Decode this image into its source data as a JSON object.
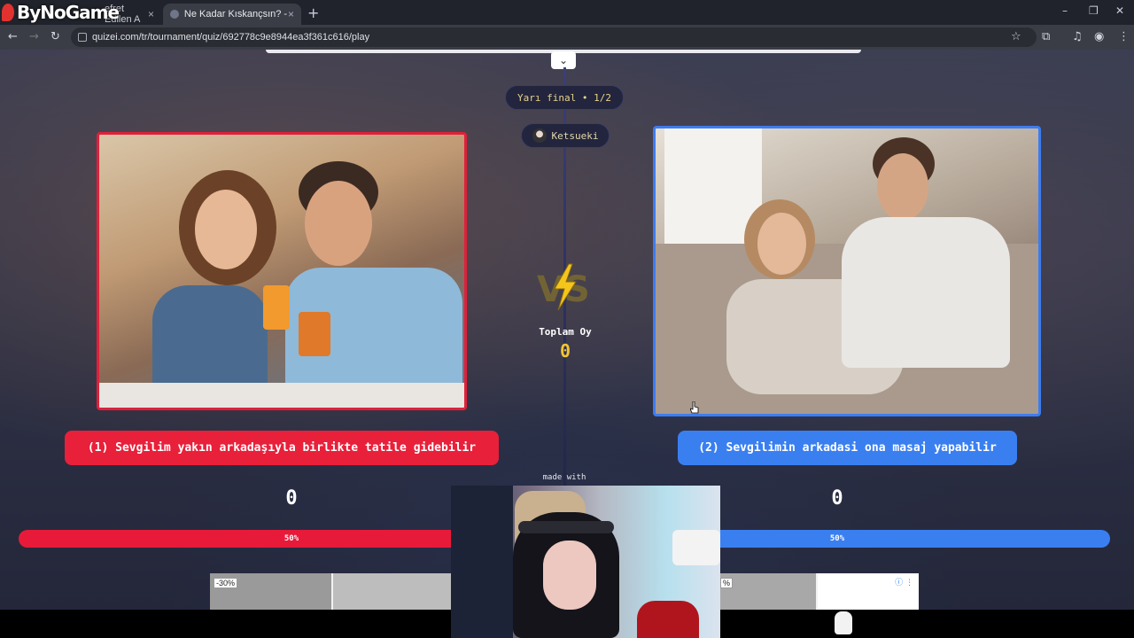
{
  "browser": {
    "tabs": [
      {
        "title": "efret Edilen A"
      },
      {
        "title": "Ne Kadar Kıskançsın? - Tier List"
      }
    ],
    "url": "quizei.com/tr/tournament/quiz/692778c9e8944ea3f361c616/play",
    "icons": {
      "new_tab": "+",
      "minimize": "–",
      "restore": "❐",
      "close": "✕",
      "back": "←",
      "forward": "→",
      "reload": "↻",
      "star": "☆",
      "extensions": "⧉",
      "media": "♫",
      "profile": "◉",
      "menu": "⋮",
      "tab_close": "×",
      "collapse": "⌄"
    }
  },
  "overlay": {
    "brand_logo": "ByNoGame"
  },
  "tournament": {
    "round": "Yarı final • 1/2",
    "username": "Ketsueki",
    "total_votes_label": "Toplam Oy",
    "total_votes": "0",
    "made_with": "made with",
    "options": [
      {
        "label": "(1) Sevgilim yakın arkadaşıyla birlikte tatile gidebilir",
        "score": "0",
        "percent_label": "50%",
        "percent": 50,
        "color": "#e8203a"
      },
      {
        "label": "(2) Sevgilimin arkadasi ona masaj yapabilir",
        "score": "0",
        "percent_label": "50%",
        "percent": 50,
        "color": "#3a7ff0"
      }
    ]
  },
  "ads": {
    "badge_left": "-30%",
    "badge_right": "%",
    "info_icon": "ⓘ ⋮"
  }
}
